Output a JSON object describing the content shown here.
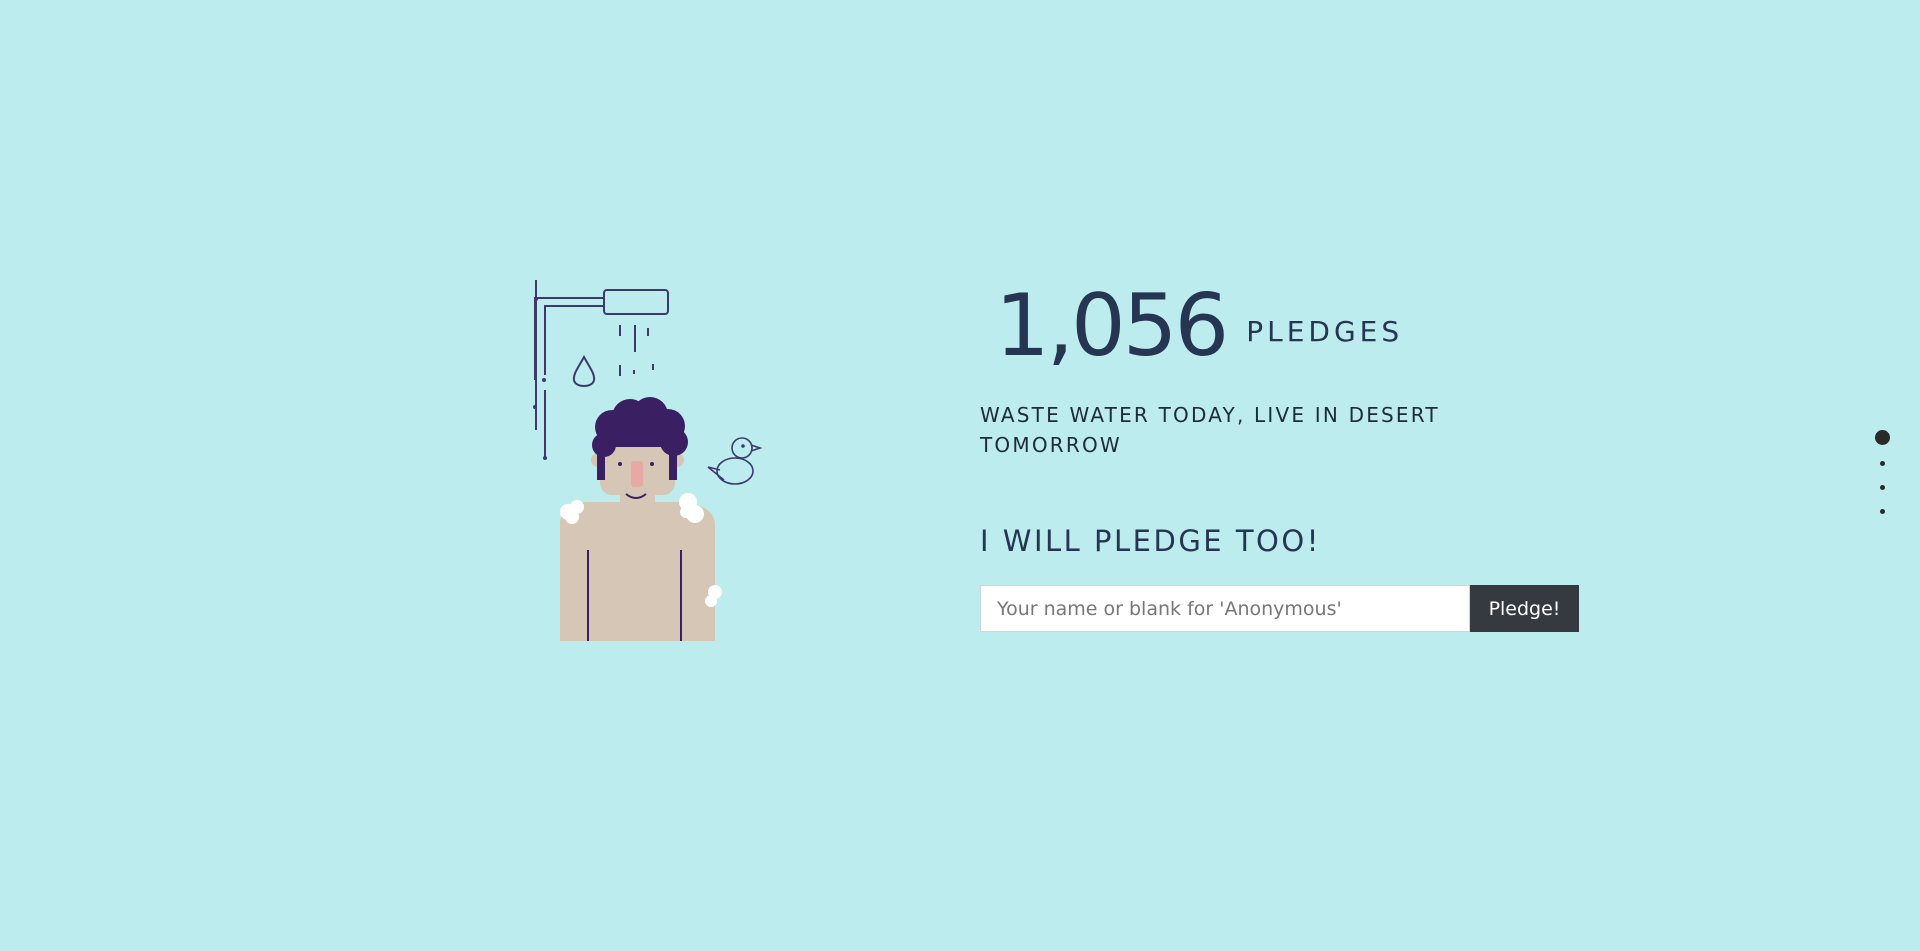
{
  "pledges": {
    "count": "1,056",
    "unit": "PLEDGES"
  },
  "slogan": "WASTE WATER TODAY, LIVE IN DESERT TOMORROW",
  "cta": {
    "heading": "I WILL PLEDGE TOO!",
    "input_placeholder": "Your name or blank for 'Anonymous'",
    "input_value": "",
    "button_label": "Pledge!"
  },
  "section_nav": {
    "active_index": 0,
    "count": 4
  },
  "colors": {
    "background": "#bcecee",
    "heading_text": "#253552",
    "button_bg": "#343a40",
    "hair": "#3b1f63",
    "skin": "#d5c6b6"
  },
  "illustration_icon": "person-showering-icon"
}
